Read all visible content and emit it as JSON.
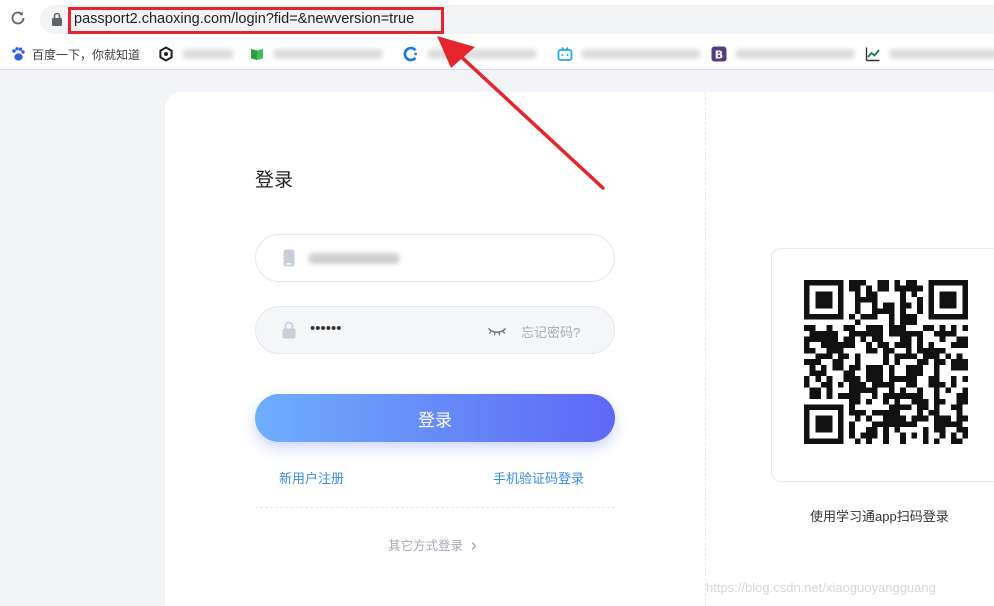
{
  "browser": {
    "url": "passport2.chaoxing.com/login?fid=&newversion=true",
    "bookmarks": [
      {
        "label": "百度一下，你就知道",
        "icon": "baidu-paw-icon"
      },
      {
        "label": "",
        "icon": "hexagon-icon"
      },
      {
        "label": "",
        "icon": "green-book-icon"
      },
      {
        "label": "",
        "icon": "blue-c-icon"
      },
      {
        "label": "",
        "icon": "bilibili-tv-icon"
      },
      {
        "label": "",
        "icon": "bootstrap-b-icon"
      },
      {
        "label": "",
        "icon": "chart-line-icon"
      }
    ]
  },
  "login": {
    "title": "登录",
    "password_mask": "••••••",
    "forgot_label": "忘记密码?",
    "submit_label": "登录",
    "register_label": "新用户注册",
    "sms_login_label": "手机验证码登录",
    "other_methods_label": "其它方式登录"
  },
  "qr": {
    "caption": "使用学习通app扫码登录"
  },
  "watermark": "https://blog.csdn.net/xiaoguoyangguang",
  "colors": {
    "accent": "#3a8ee6",
    "button_start": "#6eaefc",
    "button_end": "#5e68f5",
    "annotation_red": "#e5242b"
  }
}
